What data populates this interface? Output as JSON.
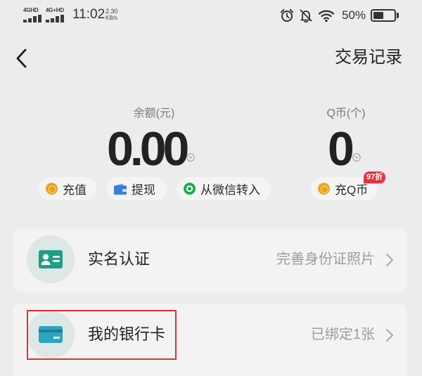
{
  "status_bar": {
    "sim1": {
      "label": "4GHD",
      "icon": "signal-icon"
    },
    "sim2": {
      "label": "4G+HD",
      "icon": "signal-icon"
    },
    "time": "11:02",
    "net_speed": "2.30",
    "net_speed_unit": "KB/s",
    "icons": [
      "alarm-icon",
      "bell-mute-icon",
      "wifi-icon",
      "battery-icon"
    ],
    "battery_text": "50%",
    "battery_level": 0.5
  },
  "header": {
    "back_icon": "back-arrow-icon",
    "title": "交易记录"
  },
  "balance": {
    "label": "余额(元)",
    "value": "0.00",
    "icon": "chevron-circle-icon"
  },
  "qcoin": {
    "label": "Q币(个)",
    "value": "0",
    "icon": "chevron-circle-icon"
  },
  "actions": [
    {
      "label": "充值",
      "icon": "coin-icon"
    },
    {
      "label": "提现",
      "icon": "wallet-icon"
    },
    {
      "label": "从微信转入",
      "icon": "wechat-pay-icon"
    },
    {
      "label": "充Q币",
      "icon": "coin-icon",
      "badge": "97折"
    }
  ],
  "rows": [
    {
      "title": "实名认证",
      "detail": "完善身份证照片",
      "icon": "id-card-icon"
    },
    {
      "title": "我的银行卡",
      "detail": "已绑定1张",
      "icon": "bank-card-icon"
    }
  ],
  "colors": {
    "background": "#ececec",
    "text": "#222222",
    "muted": "#7a7a7a",
    "card": "#f3f3f3",
    "pill": "#f4f4f4",
    "coin": "#e8a41c",
    "wallet": "#3a80d8",
    "wechat": "#1aad4b",
    "badge": "#e5323e",
    "highlight": "#e2302c",
    "icon_circle": "#dde7e5",
    "id_card": "#1f9e86",
    "bank_card": "#2aa7bf"
  }
}
